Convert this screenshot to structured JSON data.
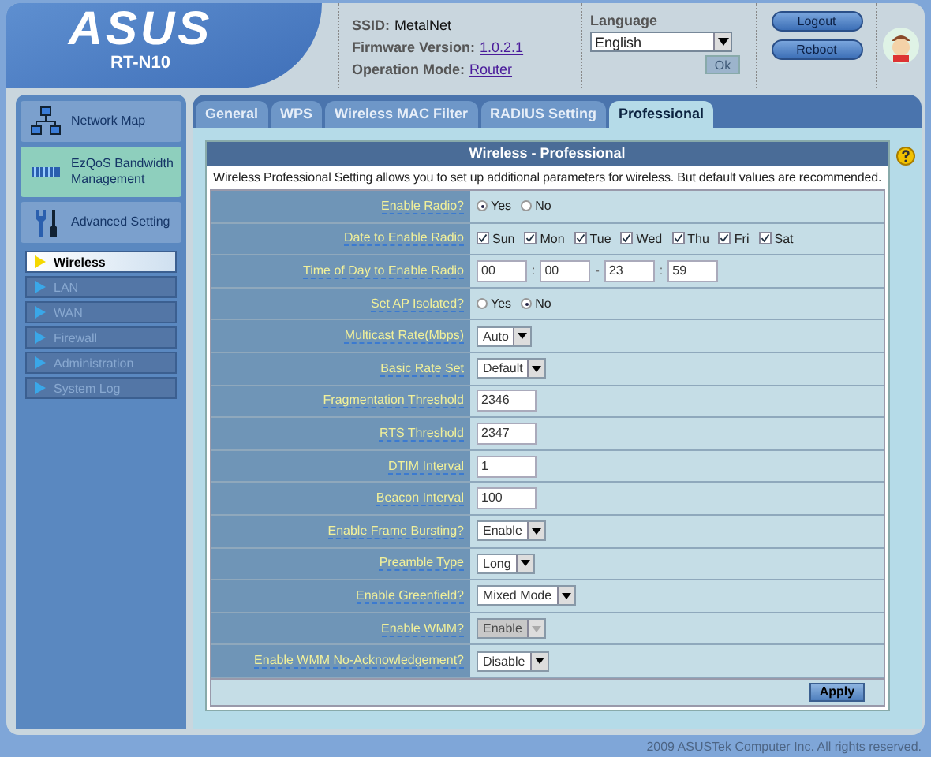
{
  "header": {
    "brand": "ASUS",
    "model": "RT-N10",
    "ssid_label": "SSID:",
    "ssid": "MetalNet",
    "firmware_label": "Firmware Version:",
    "firmware": "1.0.2.1",
    "mode_label": "Operation Mode:",
    "mode": "Router",
    "language_label": "Language",
    "language": "English",
    "ok_button": {
      "label": "Ok",
      "disabled": true
    },
    "buttons": [
      "Logout",
      "Reboot"
    ]
  },
  "sidebar": {
    "items": [
      {
        "label": "Network Map",
        "kind": "network",
        "selected": false
      },
      {
        "label": "EzQoS Bandwidth Management",
        "kind": "qos",
        "selected": true
      },
      {
        "label": "Advanced Setting",
        "kind": "tools",
        "selected": false
      }
    ],
    "submenu": [
      {
        "label": "Wireless",
        "selected": true
      },
      {
        "label": "LAN",
        "selected": false
      },
      {
        "label": "WAN",
        "selected": false
      },
      {
        "label": "Firewall",
        "selected": false
      },
      {
        "label": "Administration",
        "selected": false
      },
      {
        "label": "System Log",
        "selected": false
      }
    ]
  },
  "tabs": [
    {
      "label": "General",
      "selected": false
    },
    {
      "label": "WPS",
      "selected": false
    },
    {
      "label": "Wireless MAC Filter",
      "selected": false
    },
    {
      "label": "RADIUS Setting",
      "selected": false
    },
    {
      "label": "Professional",
      "selected": true
    }
  ],
  "panel": {
    "title": "Wireless - Professional",
    "description": "Wireless Professional Setting allows you to set up additional parameters for wireless. But default values are recommended.",
    "rows": [
      {
        "kind": "radio",
        "label": "Enable Radio?",
        "options": [
          {
            "label": "Yes",
            "selected": true
          },
          {
            "label": "No",
            "selected": false
          }
        ]
      },
      {
        "kind": "checks",
        "label": "Date to Enable Radio",
        "options": [
          {
            "label": "Sun",
            "checked": true
          },
          {
            "label": "Mon",
            "checked": true
          },
          {
            "label": "Tue",
            "checked": true
          },
          {
            "label": "Wed",
            "checked": true
          },
          {
            "label": "Thu",
            "checked": true
          },
          {
            "label": "Fri",
            "checked": true
          },
          {
            "label": "Sat",
            "checked": true
          }
        ]
      },
      {
        "kind": "time",
        "label": "Time of Day to Enable Radio",
        "parts": [
          {
            "value": "00",
            "separator": ":"
          },
          {
            "value": "00",
            "separator": "-"
          },
          {
            "value": "23",
            "separator": ":"
          },
          {
            "value": "59"
          }
        ]
      },
      {
        "kind": "radio",
        "label": "Set AP Isolated?",
        "options": [
          {
            "label": "Yes",
            "selected": false
          },
          {
            "label": "No",
            "selected": true
          }
        ]
      },
      {
        "kind": "select",
        "label": "Multicast Rate(Mbps)",
        "value": "Auto",
        "disabled": false
      },
      {
        "kind": "select",
        "label": "Basic Rate Set",
        "value": "Default",
        "disabled": false
      },
      {
        "kind": "text",
        "label": "Fragmentation Threshold",
        "value": "2346"
      },
      {
        "kind": "text",
        "label": "RTS Threshold",
        "value": "2347"
      },
      {
        "kind": "text",
        "label": "DTIM Interval",
        "value": "1"
      },
      {
        "kind": "text",
        "label": "Beacon Interval",
        "value": "100"
      },
      {
        "kind": "select",
        "label": "Enable Frame Bursting?",
        "value": "Enable",
        "disabled": false
      },
      {
        "kind": "select",
        "label": "Preamble Type",
        "value": "Long",
        "disabled": false
      },
      {
        "kind": "select",
        "label": "Enable Greenfield?",
        "value": "Mixed Mode",
        "disabled": false
      },
      {
        "kind": "select",
        "label": "Enable WMM?",
        "value": "Enable",
        "disabled": true
      },
      {
        "kind": "select",
        "label": "Enable WMM No-Acknowledgement?",
        "value": "Disable",
        "disabled": false
      }
    ],
    "apply": "Apply"
  },
  "footer": "2009 ASUSTek Computer Inc. All rights reserved."
}
